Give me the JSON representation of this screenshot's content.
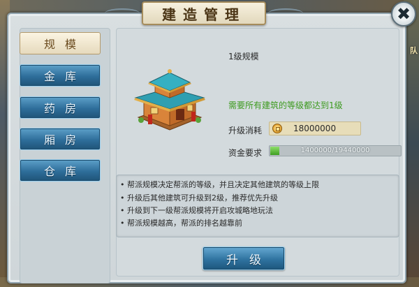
{
  "window": {
    "title": "建造管理",
    "close_symbol": "✖"
  },
  "tabs": [
    {
      "label": "规模",
      "active": true
    },
    {
      "label": "金库",
      "active": false
    },
    {
      "label": "药房",
      "active": false
    },
    {
      "label": "厢房",
      "active": false
    },
    {
      "label": "仓库",
      "active": false
    }
  ],
  "detail": {
    "level_title": "1级规模",
    "requirement": "需要所有建筑的等级都达到1级",
    "cost_label": "升级消耗",
    "cost_icon": "coin-icon",
    "cost_value": "18000000",
    "funds_label": "资金要求",
    "funds_text": "1400000/19440000",
    "funds_progress": 0.072
  },
  "description": [
    "• 帮派规模决定帮派的等级，并且决定其他建筑的等级上限",
    "• 升级后其他建筑可升级到2级，推荐优先升级",
    "• 升级到下一级帮派规模将开启攻城略地玩法",
    "• 帮派规模越高，帮派的排名越靠前"
  ],
  "upgrade_button": "升级",
  "background": {
    "right_side_text": "队"
  },
  "colors": {
    "requirement_green": "#3c9a1e",
    "tab_blue": "#2e6e9a",
    "tab_active": "#fbf4e2",
    "progress_green": "#3f9e22"
  }
}
